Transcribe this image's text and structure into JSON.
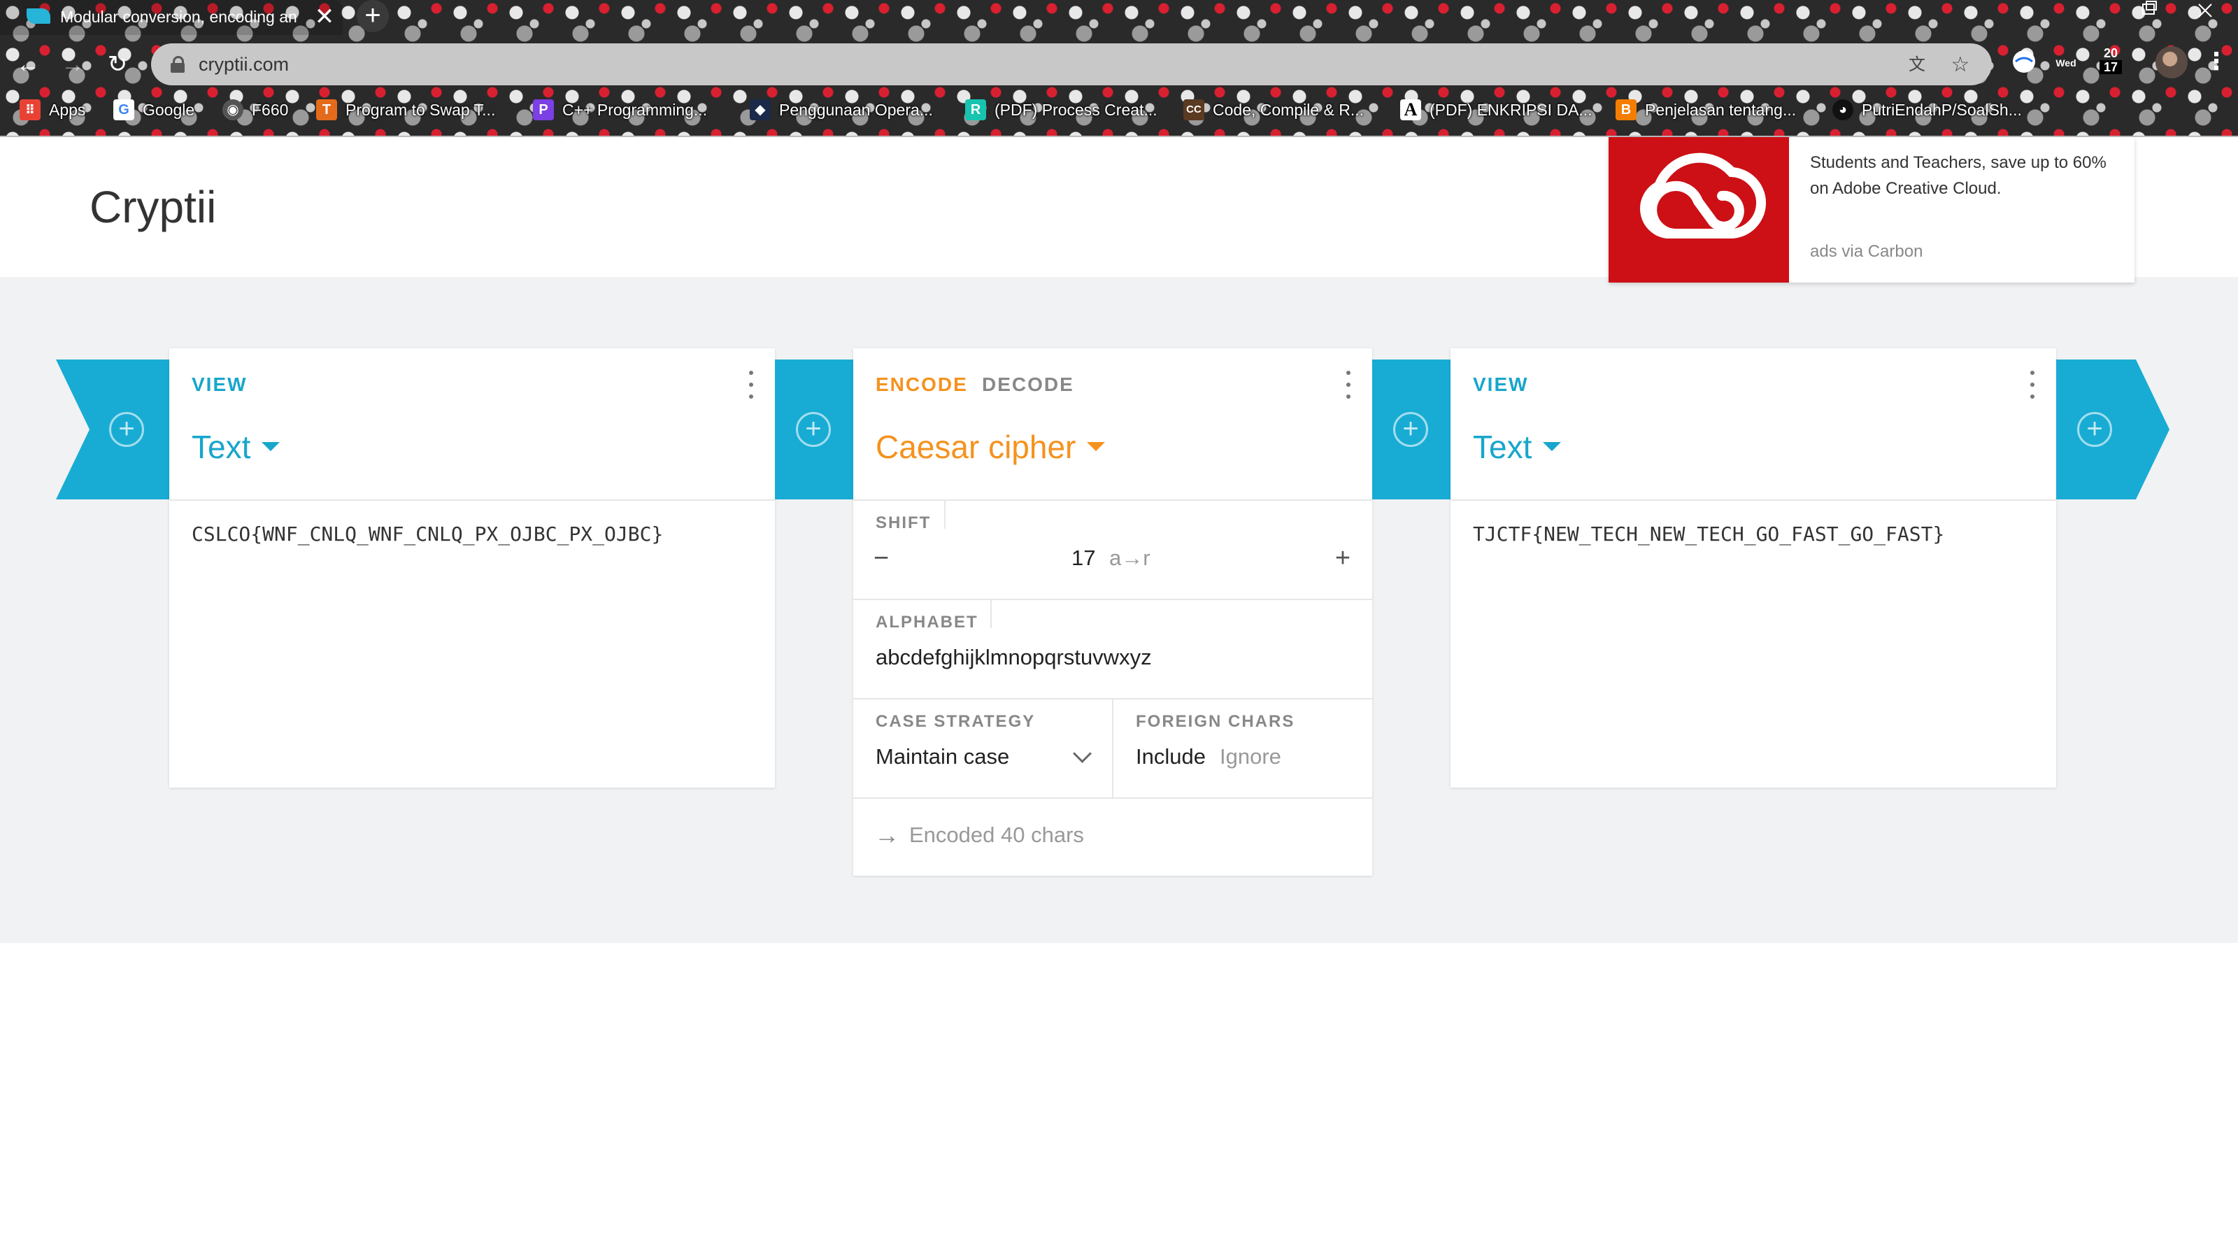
{
  "browser": {
    "tab_title": "Modular conversion, encoding and encryption online — Cryptii",
    "tab_close": "✕",
    "new_tab": "+",
    "url": "cryptii.com",
    "clock_day": "Wed",
    "clock_date": "20",
    "clock_number": "17",
    "bookmarks": [
      {
        "label": "Apps",
        "icon": "apps-grid-icon",
        "color": "#e94235"
      },
      {
        "label": "Google",
        "icon": "google-icon",
        "color": "#4285f4"
      },
      {
        "label": "F660",
        "icon": "globe-icon",
        "color": "#555555"
      },
      {
        "label": "Program to Swap T...",
        "icon": "tutorial-site-icon",
        "color": "#e46b1c"
      },
      {
        "label": "C++ Programming...",
        "icon": "p-logo-icon",
        "color": "#7b3fe4"
      },
      {
        "label": "Penggunaan Opera...",
        "icon": "dark-site-icon",
        "color": "#1b2a4a"
      },
      {
        "label": "(PDF) Process Creat...",
        "icon": "researchgate-icon",
        "color": "#17c4b0"
      },
      {
        "label": "Code, Compile & R...",
        "icon": "cc-icon",
        "color": "#5b3a22"
      },
      {
        "label": "(PDF) ENKRIPSI DA...",
        "icon": "academia-icon",
        "color": "#ffffff"
      },
      {
        "label": "Penjelasan tentang...",
        "icon": "blogger-icon",
        "color": "#f57d00"
      },
      {
        "label": "PutriEndahP/SoalSh...",
        "icon": "github-icon",
        "color": "#111111"
      }
    ]
  },
  "header": {
    "logo": "Cryptii"
  },
  "ad": {
    "text": "Students and Teachers, save up to 60% on Adobe Creative Cloud.",
    "via": "ads via Carbon"
  },
  "left_brick": {
    "label": "VIEW",
    "title": "Text",
    "content": "CSLCO{WNF_CNLQ_WNF_CNLQ_PX_OJBC_PX_OJBC}"
  },
  "middle_brick": {
    "encode_label": "ENCODE",
    "decode_label": "DECODE",
    "title": "Caesar cipher",
    "shift_label": "SHIFT",
    "shift_minus": "−",
    "shift_value": "17",
    "shift_mapping": "a→r",
    "shift_plus": "+",
    "alphabet_label": "ALPHABET",
    "alphabet_value": "abcdefghijklmnopqrstuvwxyz",
    "case_label": "CASE STRATEGY",
    "case_value": "Maintain case",
    "foreign_label": "FOREIGN CHARS",
    "foreign_include": "Include",
    "foreign_ignore": "Ignore",
    "status": "Encoded 40 chars"
  },
  "right_brick": {
    "label": "VIEW",
    "title": "Text",
    "content": "TJCTF{NEW_TECH_NEW_TECH_GO_FAST_GO_FAST}"
  },
  "colors": {
    "accent_blue": "#18acd4",
    "accent_orange": "#f5921e",
    "ad_red": "#cc1016"
  }
}
